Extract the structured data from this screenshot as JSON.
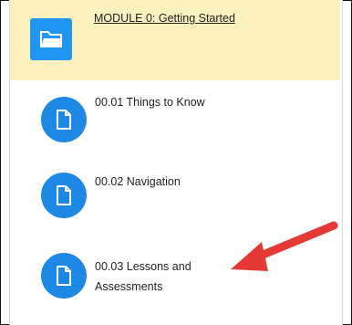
{
  "module": {
    "title": "MODULE 0: Getting Started",
    "icon": "folder-icon"
  },
  "lessons": [
    {
      "label": "00.01 Things to Know",
      "icon": "document-icon"
    },
    {
      "label": "00.02 Navigation",
      "icon": "document-icon"
    },
    {
      "label_line1": "00.03 Lessons and",
      "label_line2": "Assessments",
      "icon": "document-icon"
    }
  ],
  "colors": {
    "header_bg": "#fbf1bf",
    "icon_blue": "#1e88e5",
    "arrow_red": "#e53935"
  }
}
